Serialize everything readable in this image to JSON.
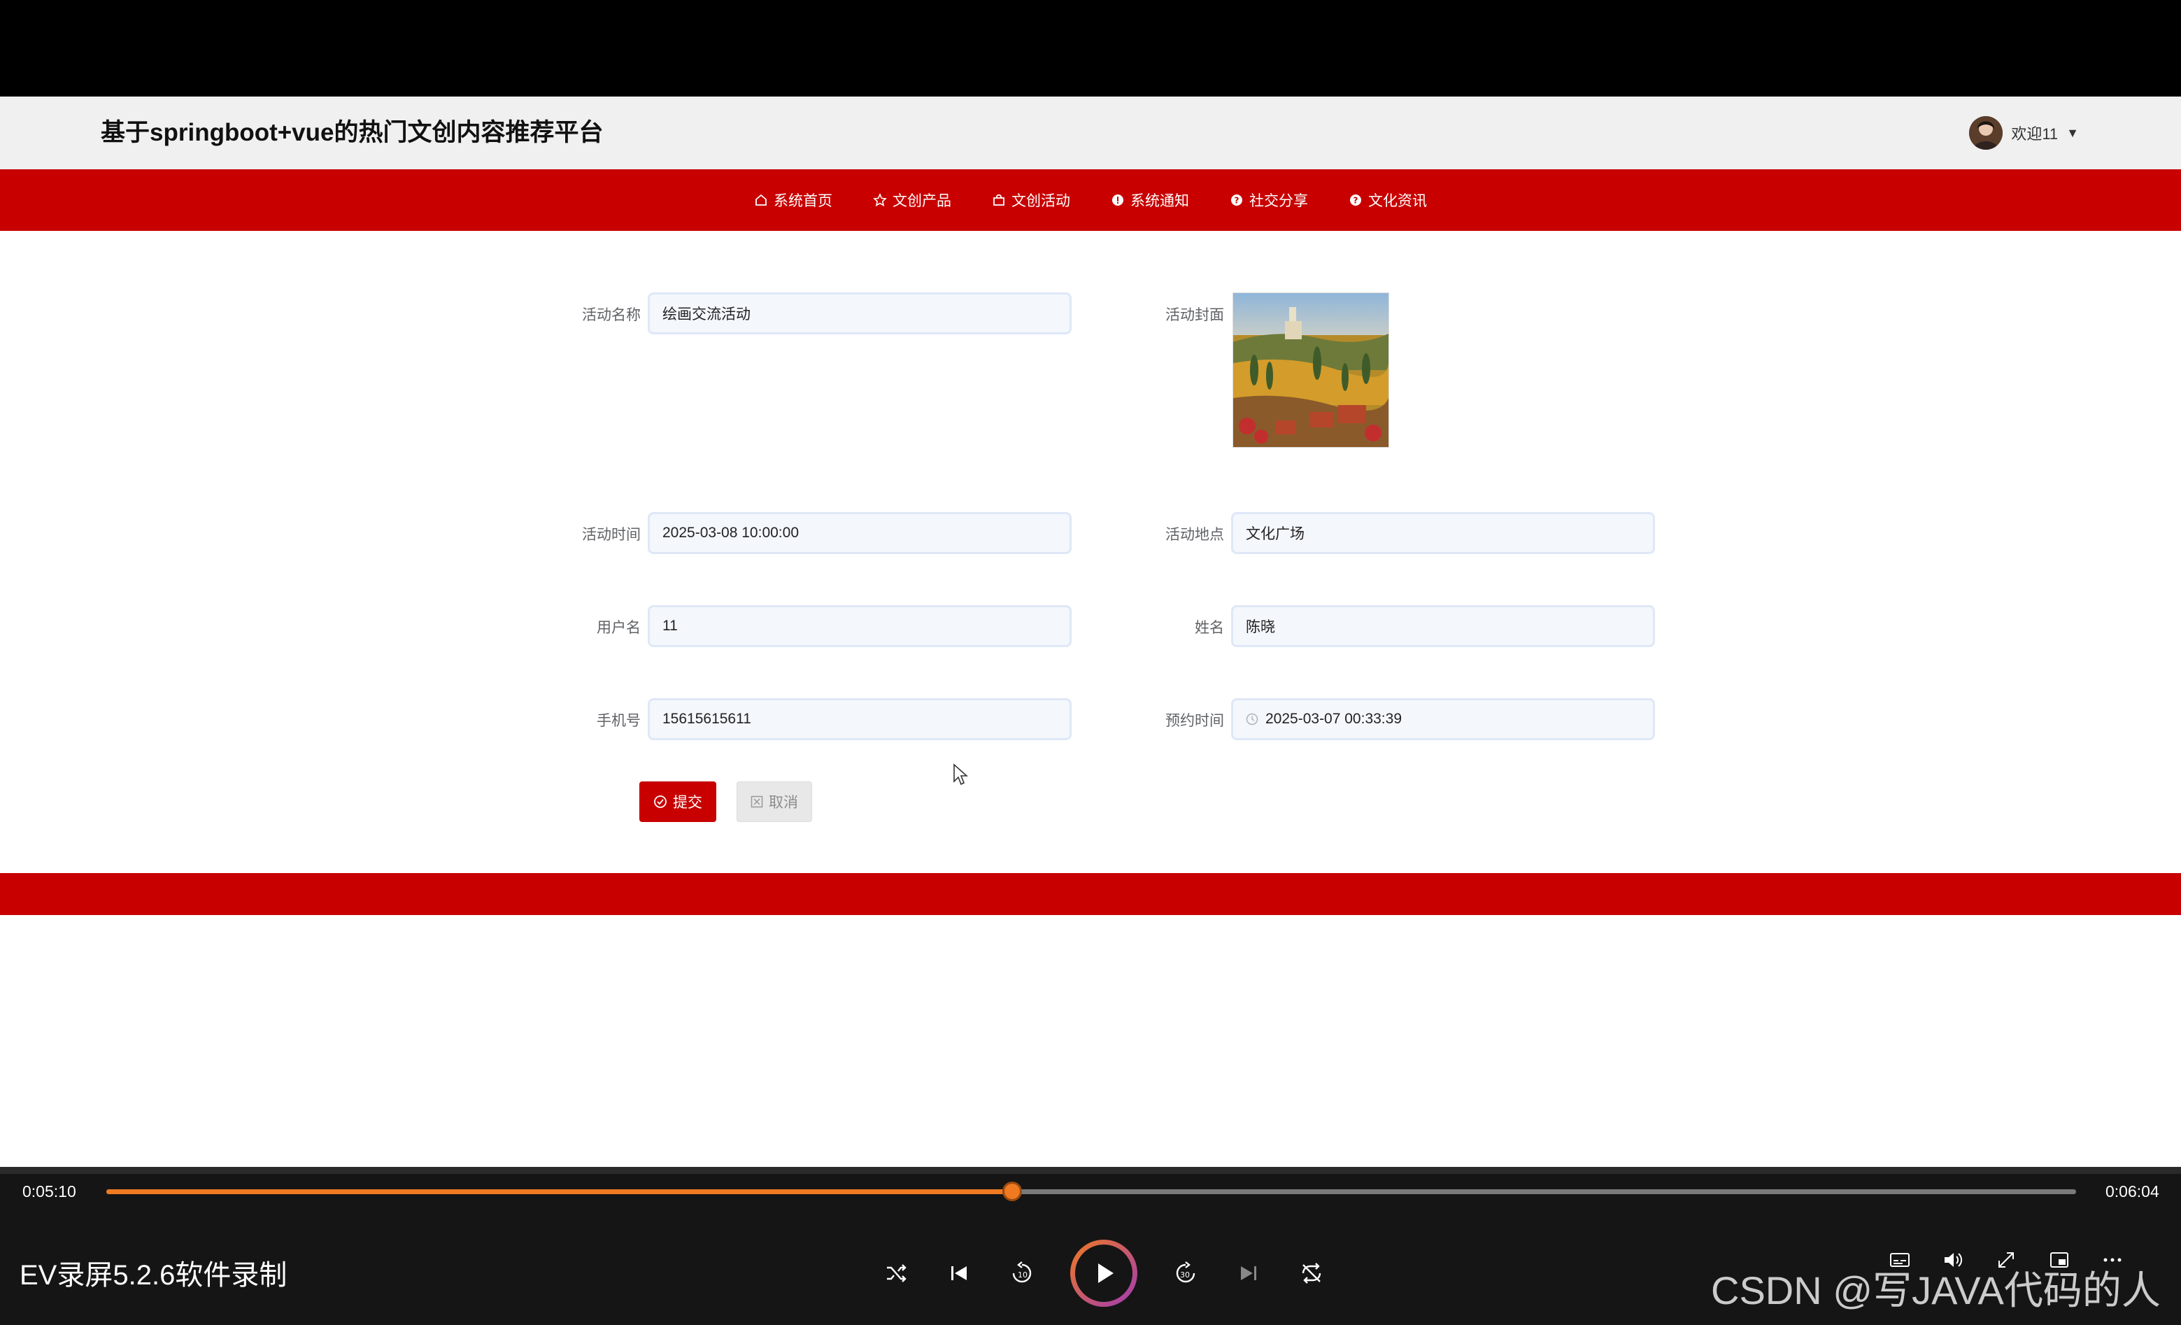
{
  "header": {
    "site_title": "基于springboot+vue的热门文创内容推荐平台",
    "welcome_text": "欢迎11"
  },
  "nav": {
    "items": [
      {
        "label": "系统首页",
        "icon": "home-icon"
      },
      {
        "label": "文创产品",
        "icon": "star-icon"
      },
      {
        "label": "文创活动",
        "icon": "bag-icon"
      },
      {
        "label": "系统通知",
        "icon": "info-icon"
      },
      {
        "label": "社交分享",
        "icon": "question-icon"
      },
      {
        "label": "文化资讯",
        "icon": "info-icon"
      }
    ]
  },
  "form": {
    "activity_name": {
      "label": "活动名称",
      "value": "绘画交流活动"
    },
    "activity_cover": {
      "label": "活动封面"
    },
    "activity_time": {
      "label": "活动时间",
      "value": "2025-03-08 10:00:00"
    },
    "activity_location": {
      "label": "活动地点",
      "value": "文化广场"
    },
    "username": {
      "label": "用户名",
      "value": "11"
    },
    "real_name": {
      "label": "姓名",
      "value": "陈晓"
    },
    "phone": {
      "label": "手机号",
      "value": "15615615611"
    },
    "booking_time": {
      "label": "预约时间",
      "value": "2025-03-07 00:33:39"
    },
    "submit_label": "提交",
    "cancel_label": "取消"
  },
  "player": {
    "current_time": "0:05:10",
    "total_time": "0:06:04",
    "progress": 0.46,
    "recorder_label": "EV录屏5.2.6软件录制",
    "watermark": "CSDN @写JAVA代码的人"
  },
  "colors": {
    "brand_red": "#c80000",
    "progress_orange": "#f07a22"
  }
}
